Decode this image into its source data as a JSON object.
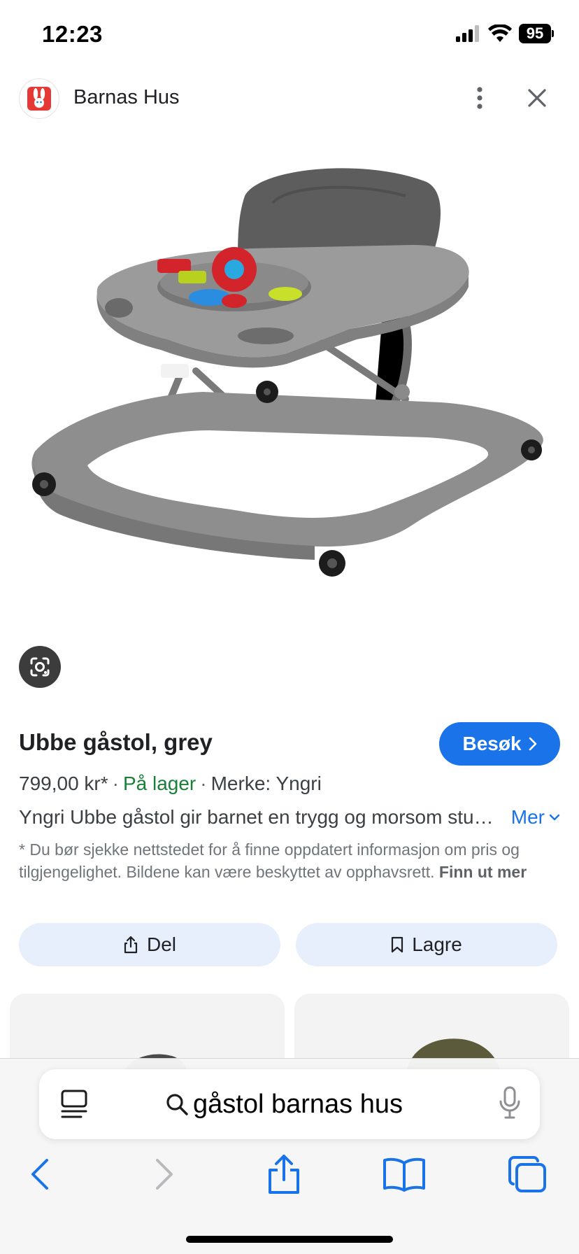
{
  "status": {
    "time": "12:23",
    "battery": "95"
  },
  "site": {
    "name": "Barnas Hus"
  },
  "product": {
    "title": "Ubbe gåstol, grey",
    "visit_label": "Besøk",
    "price": "799,00 kr*",
    "stock": "På lager",
    "brand": "Merke: Yngri",
    "description": "Yngri Ubbe gåstol gir barnet en trygg og morsom stund på gulvet",
    "more_label": "Mer",
    "disclaimer": "* Du bør sjekke nettstedet for å finne oppdatert informasjon om pris og tilgjengelighet. Bildene kan være beskyttet av opphavsrett.",
    "disclaimer_link": "Finn ut mer",
    "share_label": "Del",
    "save_label": "Lagre"
  },
  "browser": {
    "address": "gåstol barnas hus"
  },
  "colors": {
    "accent": "#1a73e8",
    "stock": "#188038",
    "chip_bg": "#e8effc"
  }
}
